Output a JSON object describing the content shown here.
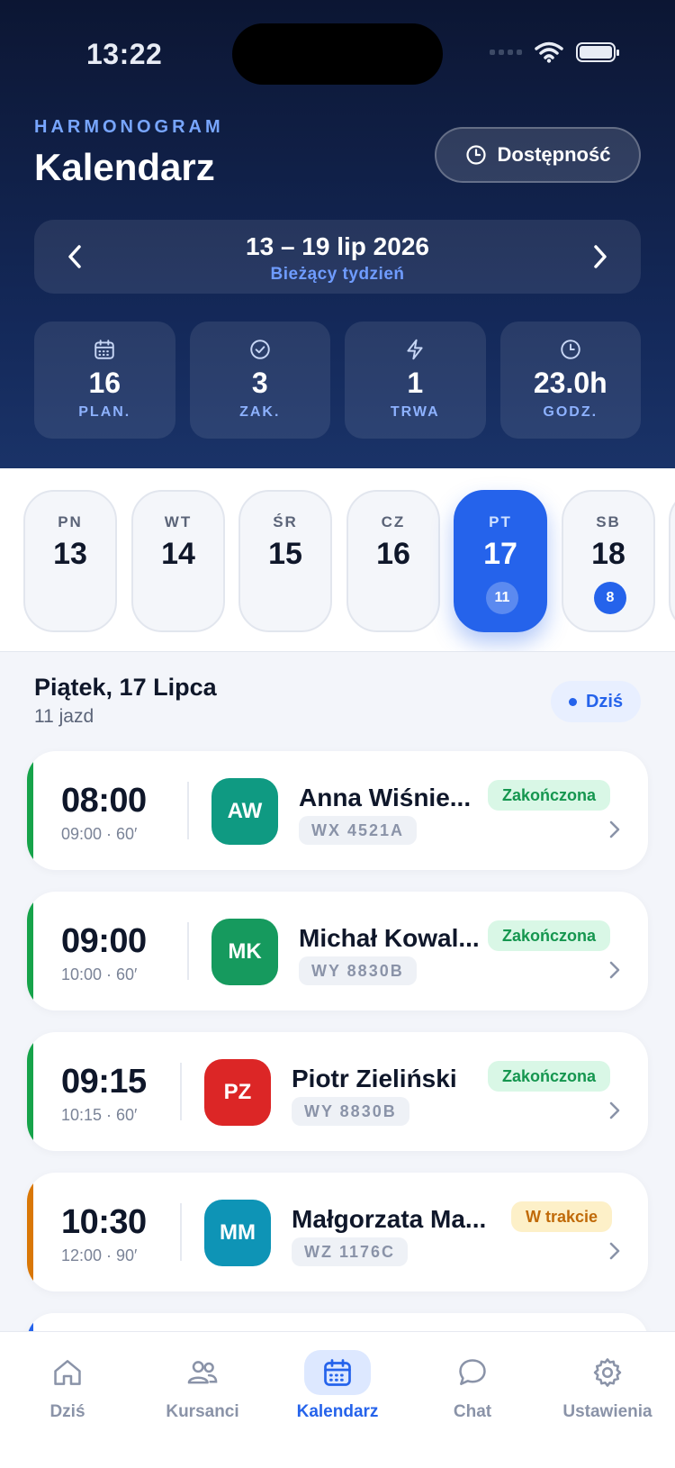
{
  "status_bar": {
    "time": "13:22"
  },
  "header": {
    "eyebrow": "HARMONOGRAM",
    "title": "Kalendarz",
    "availability_button": "Dostępność"
  },
  "week": {
    "range": "13 – 19 lip 2026",
    "subtitle": "Bieżący tydzień"
  },
  "stats": [
    {
      "icon": "calendar-icon",
      "value": "16",
      "label": "PLAN."
    },
    {
      "icon": "check-circle-icon",
      "value": "3",
      "label": "ZAK."
    },
    {
      "icon": "bolt-icon",
      "value": "1",
      "label": "TRWA"
    },
    {
      "icon": "clock-icon",
      "value": "23.0h",
      "label": "GODZ."
    }
  ],
  "days": [
    {
      "name": "PN",
      "date": "13",
      "count": ""
    },
    {
      "name": "WT",
      "date": "14",
      "count": ""
    },
    {
      "name": "ŚR",
      "date": "15",
      "count": ""
    },
    {
      "name": "CZ",
      "date": "16",
      "count": ""
    },
    {
      "name": "PT",
      "date": "17",
      "count": "11",
      "selected": true
    },
    {
      "name": "SB",
      "date": "18",
      "count": "8"
    }
  ],
  "selected_day": {
    "title": "Piątek, 17 Lipca",
    "subtitle": "11 jazd",
    "today_label": "Dziś"
  },
  "colors": {
    "accent": "#2563eb",
    "done": "#16a34a",
    "in_progress": "#d97706",
    "avatar_aw": "#0f9a82",
    "avatar_mk": "#169a5e",
    "avatar_pz": "#dc2626",
    "avatar_mm": "#0e94b6"
  },
  "lessons": [
    {
      "start": "08:00",
      "meta": "09:00 · 60′",
      "initials": "AW",
      "name": "Anna Wiśnie...",
      "plate": "WX 4521A",
      "status": "Zakończona"
    },
    {
      "start": "09:00",
      "meta": "10:00 · 60′",
      "initials": "MK",
      "name": "Michał Kowal...",
      "plate": "WY 8830B",
      "status": "Zakończona"
    },
    {
      "start": "09:15",
      "meta": "10:15 · 60′",
      "initials": "PZ",
      "name": "Piotr Zieliński",
      "plate": "WY 8830B",
      "status": "Zakończona"
    },
    {
      "start": "10:30",
      "meta": "12:00 · 90′",
      "initials": "MM",
      "name": "Małgorzata Ma...",
      "plate": "WZ 1176C",
      "status": "W trakcie"
    }
  ],
  "tabs": [
    {
      "icon": "home-icon",
      "label": "Dziś"
    },
    {
      "icon": "users-icon",
      "label": "Kursanci"
    },
    {
      "icon": "calendar-icon",
      "label": "Kalendarz",
      "active": true
    },
    {
      "icon": "chat-icon",
      "label": "Chat"
    },
    {
      "icon": "gear-icon",
      "label": "Ustawienia"
    }
  ]
}
